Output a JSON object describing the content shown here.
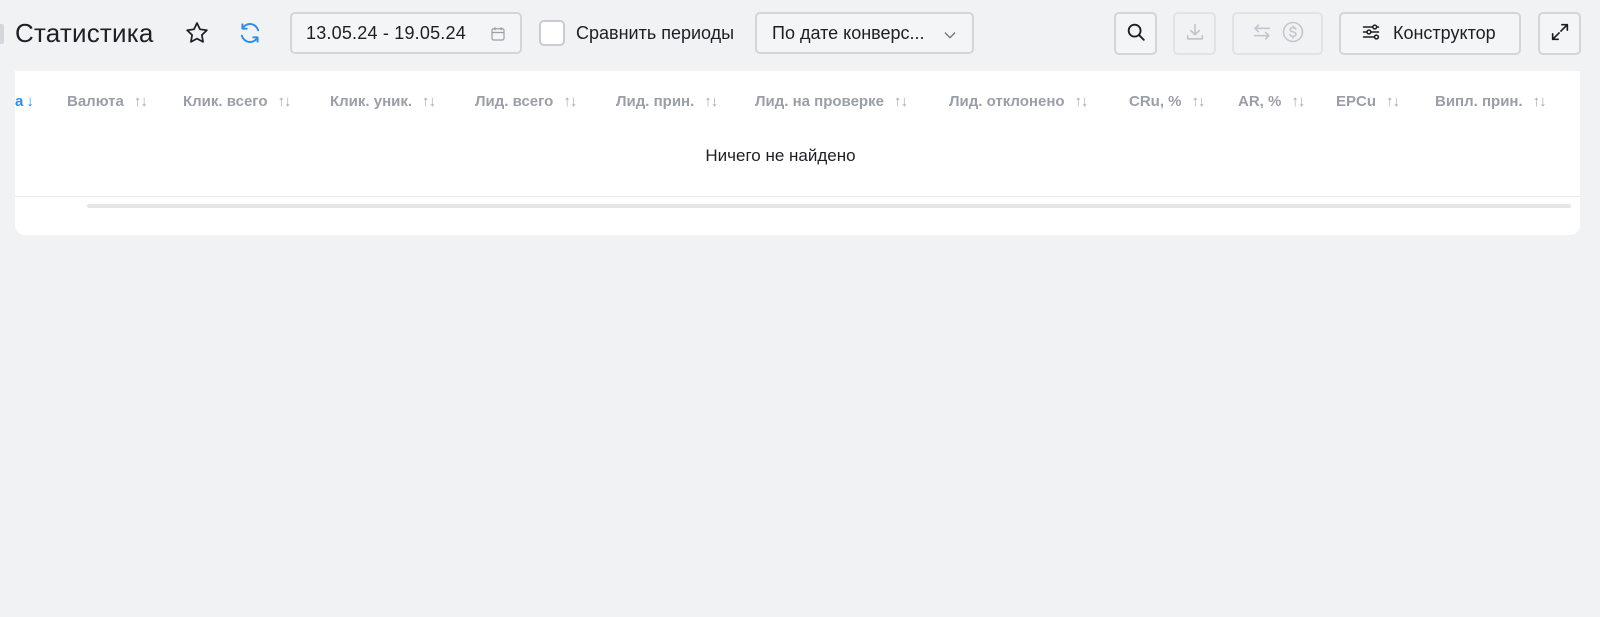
{
  "header": {
    "title": "Статистика",
    "date_range": "13.05.24 - 19.05.24",
    "compare_label": "Сравнить периоды",
    "compare_checked": false,
    "date_mode": "По дате конверс...",
    "constructor_label": "Конструктор"
  },
  "icons": {
    "star": "star-icon",
    "refresh": "refresh-icon",
    "calendar": "calendar-icon",
    "chevron": "chevron-down-icon",
    "search": "search-icon",
    "download": "download-icon",
    "convert": "swap-icon",
    "currency": "dollar-circle-icon",
    "settings": "sliders-icon",
    "expand": "expand-icon"
  },
  "table": {
    "columns": [
      {
        "label": "а",
        "sort": "↓",
        "active": true
      },
      {
        "label": "Валюта",
        "sort": "↑↓"
      },
      {
        "label": "Клик. всего",
        "sort": "↑↓"
      },
      {
        "label": "Клик. уник.",
        "sort": "↑↓"
      },
      {
        "label": "Лид. всего",
        "sort": "↑↓"
      },
      {
        "label": "Лид. прин.",
        "sort": "↑↓"
      },
      {
        "label": "Лид. на проверке",
        "sort": "↑↓"
      },
      {
        "label": "Лид. отклонено",
        "sort": "↑↓"
      },
      {
        "label": "CRu, %",
        "sort": "↑↓"
      },
      {
        "label": "AR, %",
        "sort": "↑↓"
      },
      {
        "label": "EPCu",
        "sort": "↑↓"
      },
      {
        "label": "Випл. прин.",
        "sort": "↑↓"
      }
    ],
    "empty_message": "Ничего не найдено"
  },
  "colors": {
    "accent": "#2d8fe8",
    "background": "#f1f2f4",
    "header_text": "#9a9ea6"
  }
}
